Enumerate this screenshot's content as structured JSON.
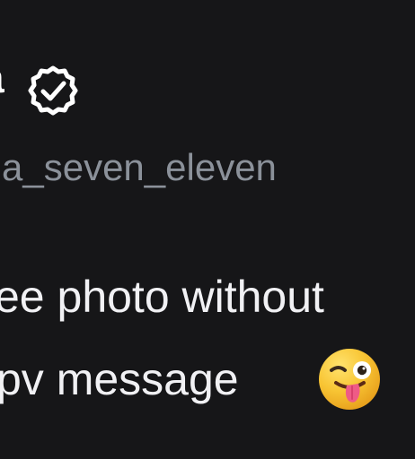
{
  "profile": {
    "display_name_fragment": "a",
    "verified_icon": "verified-check-icon",
    "username": "a_seven_eleven"
  },
  "bio": {
    "line_1": "ee photo without",
    "line_2": "pv message",
    "emoji": "winking-face-with-tongue-icon"
  },
  "colors": {
    "background": "#161618",
    "primary_text": "#ffffff",
    "secondary_text": "#8b919a",
    "emoji_yellow": "#f5b623",
    "tongue_pink": "#e94d74"
  }
}
